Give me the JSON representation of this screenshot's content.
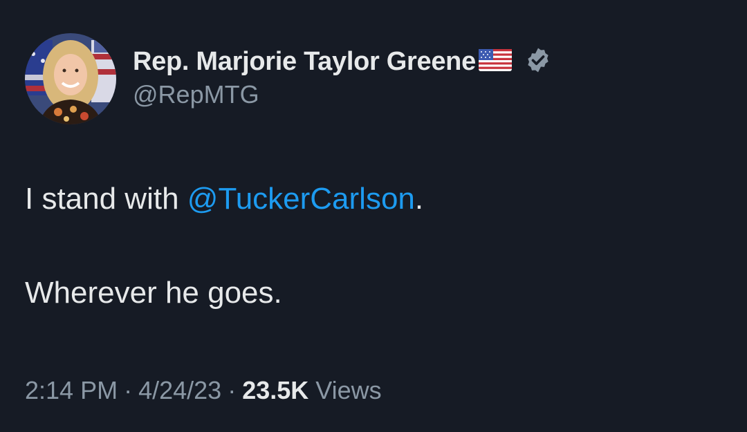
{
  "author": {
    "display_name": "Rep. Marjorie Taylor Greene",
    "handle": "@RepMTG",
    "flag_icon": "us-flag-icon",
    "verified_icon": "verified-badge-icon",
    "avatar_icon": "profile-photo"
  },
  "tweet": {
    "prefix": "I stand with ",
    "mention": "@TuckerCarlson",
    "suffix": ".",
    "line2": "Wherever he goes."
  },
  "meta": {
    "time": "2:14 PM",
    "separator": "·",
    "date": "4/24/23",
    "views_count": "23.5K",
    "views_label": "Views"
  },
  "colors": {
    "background": "#161b25",
    "text": "#e7e9ea",
    "muted": "#8b98a5",
    "link": "#1d9bf0"
  }
}
